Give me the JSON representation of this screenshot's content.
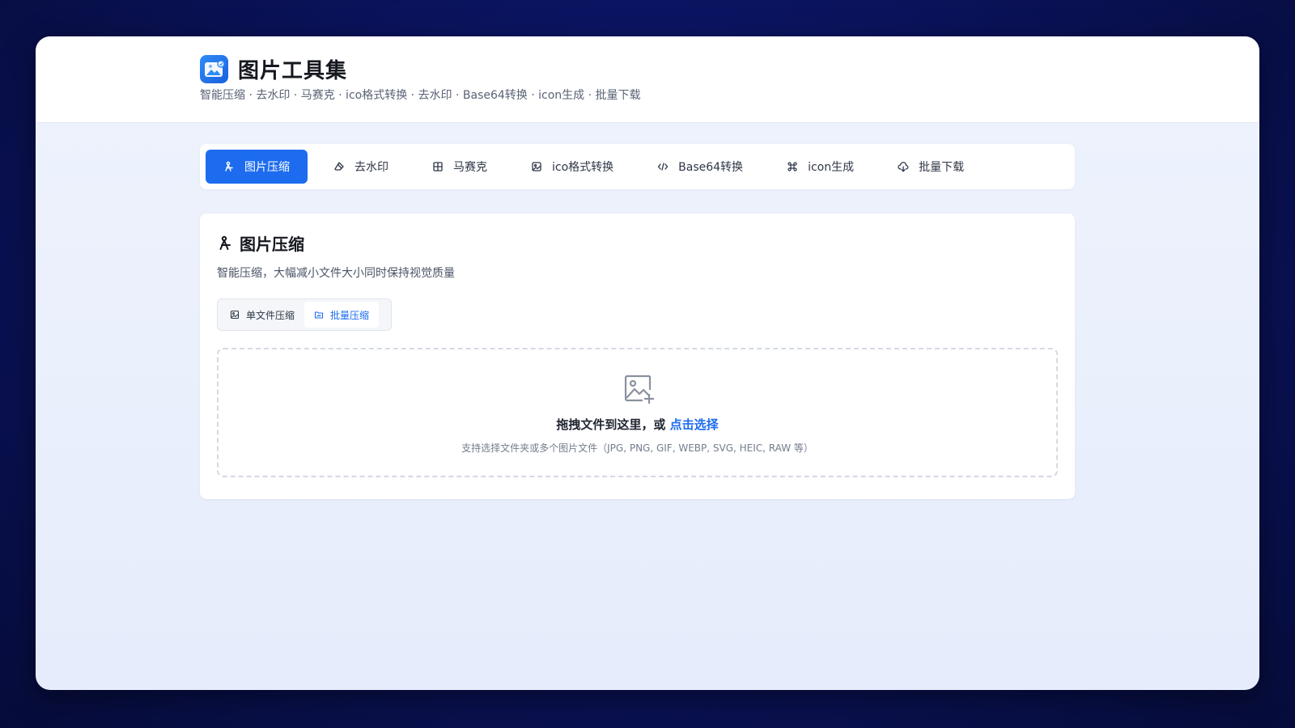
{
  "app": {
    "title": "图片工具集",
    "subtitle": "智能压缩 · 去水印 · 马赛克 · ico格式转换 · 去水印 · Base64转换 · icon生成 · 批量下载",
    "logo_icon": "image-logo-icon"
  },
  "tabs": [
    {
      "label": "图片压缩",
      "icon": "compress-icon",
      "active": true
    },
    {
      "label": "去水印",
      "icon": "eraser-icon",
      "active": false
    },
    {
      "label": "马赛克",
      "icon": "grid-icon",
      "active": false
    },
    {
      "label": "ico格式转换",
      "icon": "image-icon",
      "active": false
    },
    {
      "label": "Base64转换",
      "icon": "code-icon",
      "active": false
    },
    {
      "label": "icon生成",
      "icon": "command-icon",
      "active": false
    },
    {
      "label": "批量下载",
      "icon": "cloud-download-icon",
      "active": false
    }
  ],
  "panel": {
    "title": "图片压缩",
    "description": "智能压缩，大幅减小文件大小同时保持视觉质量",
    "modes": [
      {
        "label": "单文件压缩",
        "icon": "image-icon",
        "active": false
      },
      {
        "label": "批量压缩",
        "icon": "folder-image-icon",
        "active": true
      }
    ],
    "dropzone": {
      "text": "拖拽文件到这里，或 ",
      "link": "点击选择",
      "hint": "支持选择文件夹或多个图片文件（JPG, PNG, GIF, WEBP, SVG, HEIC, RAW 等）",
      "icon": "image-add-icon"
    }
  },
  "colors": {
    "accent": "#1d6cf0",
    "text_primary": "#15181f",
    "text_secondary": "#596274",
    "background": "#e9eefb"
  }
}
